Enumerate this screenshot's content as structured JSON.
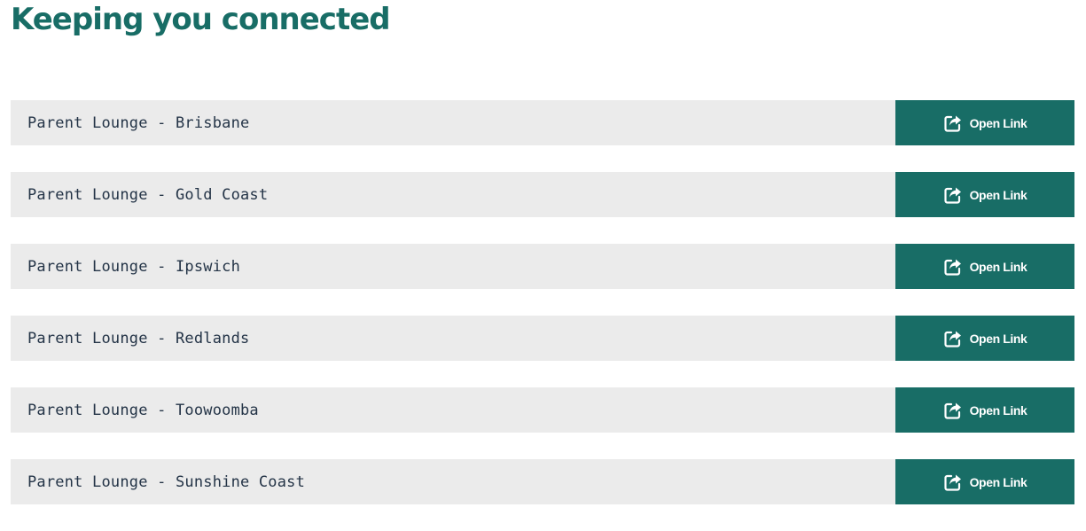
{
  "page": {
    "title": "Keeping you connected"
  },
  "links": {
    "button_label": "Open Link",
    "button_icon": "share-arrow-icon",
    "items": [
      {
        "label": "Parent Lounge - Brisbane"
      },
      {
        "label": "Parent Lounge - Gold Coast"
      },
      {
        "label": "Parent Lounge - Ipswich"
      },
      {
        "label": "Parent Lounge - Redlands"
      },
      {
        "label": "Parent Lounge - Toowoomba"
      },
      {
        "label": "Parent Lounge - Sunshine Coast"
      }
    ]
  },
  "colors": {
    "accent": "#186d66",
    "row_background": "#ebebeb",
    "label_text": "#243447",
    "button_text": "#ffffff"
  }
}
